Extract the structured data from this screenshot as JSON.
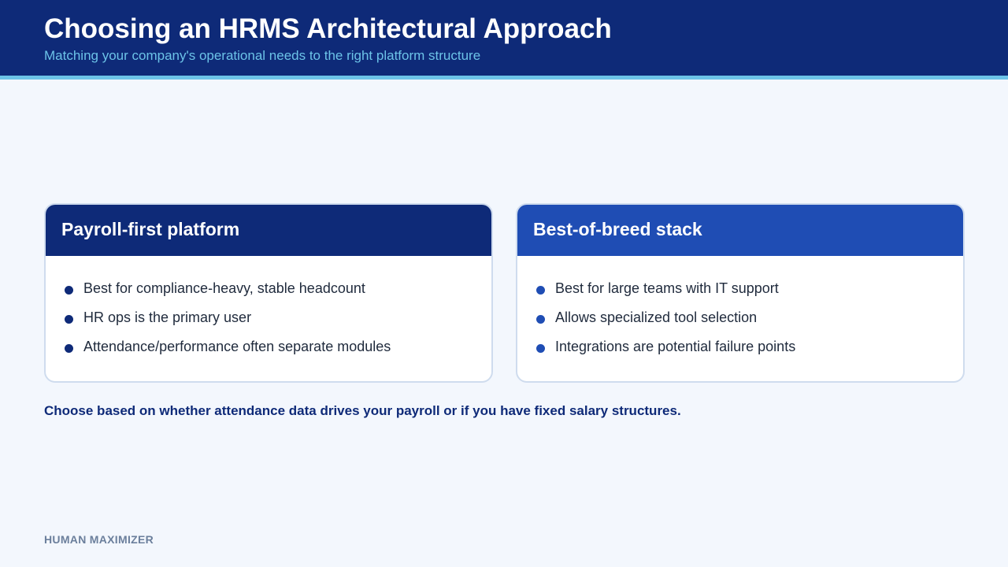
{
  "header": {
    "title": "Choosing an HRMS Architectural Approach",
    "subtitle": "Matching your company's operational needs to the right platform structure"
  },
  "cards": [
    {
      "title": "Payroll-first platform",
      "items": [
        "Best for compliance-heavy, stable headcount",
        "HR ops is the primary user",
        "Attendance/performance often separate modules"
      ]
    },
    {
      "title": "Best-of-breed stack",
      "items": [
        "Best for large teams with IT support",
        "Allows specialized tool selection",
        "Integrations are potential failure points"
      ]
    }
  ],
  "takeaway": "Choose based on whether attendance data drives your payroll or if you have fixed salary structures.",
  "footer": {
    "brand": "HUMAN MAXIMIZER"
  },
  "colors": {
    "header_bg": "#0e2a78",
    "accent": "#6cc3e8",
    "card_left_head": "#0e2a78",
    "card_right_head": "#1f4db4",
    "background": "#f3f7fd"
  }
}
